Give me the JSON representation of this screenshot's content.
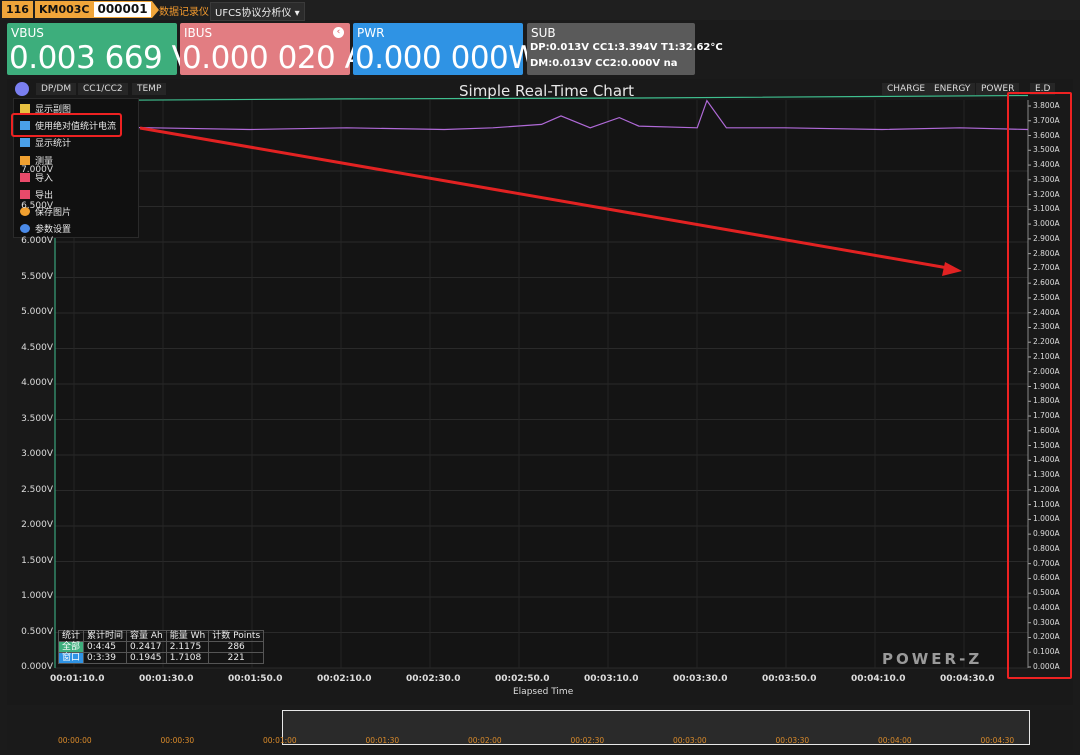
{
  "header": {
    "device_num": "116",
    "device_model": "KM003C",
    "serial": "000001",
    "tab_recorder": "数据记录仪",
    "tab_analyzer": "UFCS协议分析仪",
    "analyzer_caret": "▾"
  },
  "cards": {
    "vbus": {
      "label": "VBUS",
      "value": "0.003 669 V"
    },
    "ibus": {
      "label": "IBUS",
      "value": "0.000 020 A"
    },
    "pwr": {
      "label": "PWR",
      "value": "0.000 000W"
    },
    "sub": {
      "label": "SUB",
      "line1": "DP:0.013V   CC1:3.394V  T1:32.62°C",
      "line2": "DM:0.013V   CC2:0.000V  na"
    }
  },
  "toolbar": {
    "chips_left": [
      "DP/DM",
      "CC1/CC2",
      "TEMP"
    ],
    "chips_right": [
      "CHARGE",
      "ENERGY",
      "POWER",
      "E.D"
    ]
  },
  "menu": {
    "items": [
      {
        "label": "显示副图",
        "icon": "list-icon",
        "color": "#e8c040"
      },
      {
        "label": "使用绝对值统计电流",
        "icon": "chart-icon",
        "color": "#4aa0e8"
      },
      {
        "label": "显示统计",
        "icon": "bar-chart-icon",
        "color": "#4aa0e8"
      },
      {
        "label": "测量",
        "icon": "ruler-icon",
        "color": "#f0a030"
      },
      {
        "label": "导入",
        "icon": "import-icon",
        "color": "#e84a6a"
      },
      {
        "label": "导出",
        "icon": "export-icon",
        "color": "#e84a6a"
      },
      {
        "label": "保存图片",
        "icon": "image-icon",
        "color": "#f0a030"
      },
      {
        "label": "参数设置",
        "icon": "gear-icon",
        "color": "#4a8ae8"
      }
    ]
  },
  "chart_data": {
    "type": "line",
    "title": "Simple Real-Time Chart",
    "xlabel": "Elapsed Time",
    "ylabel_left": "",
    "ylabel_right": "",
    "x_ticks": [
      "00:01:10.0",
      "00:01:30.0",
      "00:01:50.0",
      "00:02:10.0",
      "00:02:30.0",
      "00:02:50.0",
      "00:03:10.0",
      "00:03:30.0",
      "00:03:50.0",
      "00:04:10.0",
      "00:04:30.0"
    ],
    "y_left_ticks": [
      "7.000V",
      "6.500V",
      "6.000V",
      "5.500V",
      "5.000V",
      "4.500V",
      "4.000V",
      "3.500V",
      "3.000V",
      "2.500V",
      "2.000V",
      "1.500V",
      "1.000V",
      "0.500V",
      "0.000V"
    ],
    "y_left_range": [
      0,
      8.0
    ],
    "y_right_ticks": [
      "3.800A",
      "3.700A",
      "3.600A",
      "3.500A",
      "3.400A",
      "3.300A",
      "3.200A",
      "3.100A",
      "3.000A",
      "2.900A",
      "2.800A",
      "2.700A",
      "2.600A",
      "2.500A",
      "2.400A",
      "2.300A",
      "2.200A",
      "2.100A",
      "2.000A",
      "1.900A",
      "1.800A",
      "1.700A",
      "1.600A",
      "1.500A",
      "1.400A",
      "1.300A",
      "1.200A",
      "1.100A",
      "1.000A",
      "0.900A",
      "0.800A",
      "0.700A",
      "0.600A",
      "0.500A",
      "0.400A",
      "0.300A",
      "0.200A",
      "0.100A",
      "0.000A"
    ],
    "y_right_range": [
      0,
      3.8
    ],
    "series": [
      {
        "color": "#3fbf8f",
        "points": [
          [
            0,
            3.33
          ],
          [
            0.3,
            3.34
          ],
          [
            0.6,
            3.345
          ],
          [
            1.0,
            3.36
          ]
        ]
      },
      {
        "color": "#b06ad8",
        "points": [
          [
            0,
            3.18
          ],
          [
            0.1,
            3.17
          ],
          [
            0.2,
            3.16
          ],
          [
            0.3,
            3.17
          ],
          [
            0.4,
            3.16
          ],
          [
            0.45,
            3.17
          ],
          [
            0.5,
            3.19
          ],
          [
            0.52,
            3.24
          ],
          [
            0.55,
            3.17
          ],
          [
            0.58,
            3.23
          ],
          [
            0.6,
            3.18
          ],
          [
            0.66,
            3.17
          ],
          [
            0.67,
            3.33
          ],
          [
            0.69,
            3.17
          ],
          [
            0.75,
            3.17
          ],
          [
            0.85,
            3.16
          ],
          [
            0.93,
            3.17
          ],
          [
            1.0,
            3.16
          ]
        ]
      }
    ]
  },
  "stats": {
    "headers": [
      "统计",
      "累计时间",
      "容量 Ah",
      "能量 Wh",
      "计数 Points"
    ],
    "rows": [
      {
        "tag": "全部",
        "time": "0:4:45",
        "ah": "0.2417",
        "wh": "2.1175",
        "points": "286"
      },
      {
        "tag": "窗口",
        "time": "0:3:39",
        "ah": "0.1945",
        "wh": "1.7108",
        "points": "221"
      }
    ]
  },
  "logo": "POWER-Z",
  "navigator": {
    "ticks": [
      "00:00:00",
      "00:00:30",
      "00:01:00",
      "00:01:30",
      "00:02:00",
      "00:02:30",
      "00:03:00",
      "00:03:30",
      "00:04:00",
      "00:04:30"
    ]
  },
  "annotation": {
    "color": "#e22222"
  }
}
